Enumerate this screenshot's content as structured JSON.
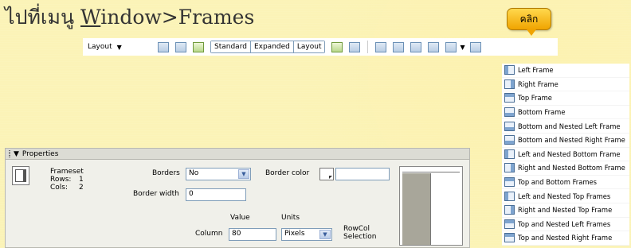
{
  "heading": {
    "prefix": "ไปที่เมนู ",
    "underlined": "W",
    "rest": "indow>Frames"
  },
  "callout": {
    "text": "คลิก"
  },
  "toolbar": {
    "layout_label": "Layout",
    "modes": [
      "Standard",
      "Expanded",
      "Layout"
    ]
  },
  "frames_menu": {
    "items": [
      {
        "label": "Left Frame",
        "icon": "left"
      },
      {
        "label": "Right Frame",
        "icon": "right"
      },
      {
        "label": "Top Frame",
        "icon": "top"
      },
      {
        "label": "Bottom Frame",
        "icon": "bottom"
      },
      {
        "label": "Bottom and Nested Left Frame",
        "icon": "bottom"
      },
      {
        "label": "Bottom and Nested Right Frame",
        "icon": "bottom"
      },
      {
        "label": "Left and Nested Bottom Frame",
        "icon": "left"
      },
      {
        "label": "Right and Nested Bottom Frame",
        "icon": "right"
      },
      {
        "label": "Top and Bottom Frames",
        "icon": "top"
      },
      {
        "label": "Left and Nested Top Frames",
        "icon": "left"
      },
      {
        "label": "Right and Nested Top Frame",
        "icon": "right"
      },
      {
        "label": "Top and Nested Left Frames",
        "icon": "top"
      },
      {
        "label": "Top and Nested Right Frame",
        "icon": "top"
      }
    ]
  },
  "properties": {
    "title": "Properties",
    "type_label": "Frameset",
    "rows_label": "Rows:",
    "rows_value": "1",
    "cols_label": "Cols:",
    "cols_value": "2",
    "borders_label": "Borders",
    "borders_value": "No",
    "border_color_label": "Border color",
    "border_width_label": "Border width",
    "border_width_value": "0",
    "value_header": "Value",
    "units_header": "Units",
    "column_label": "Column",
    "column_value": "80",
    "units_value": "Pixels",
    "rowcol_label_1": "RowCol",
    "rowcol_label_2": "Selection"
  }
}
